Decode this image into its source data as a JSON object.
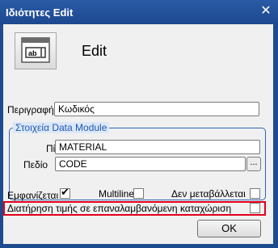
{
  "window": {
    "title": "Ιδιότητες Edit",
    "close_glyph": "✕"
  },
  "header": {
    "icon": "edit-control-icon",
    "icon_text": "ab",
    "title": "Edit"
  },
  "description": {
    "label": "Περιγραφή",
    "value": "Κωδικός"
  },
  "data_module": {
    "group_title": "Στοιχεία Data Module",
    "table_label": "Πίνακας",
    "table_value": "MATERIAL",
    "field_label": "Πεδίο",
    "field_value": "CODE",
    "browse_label": "..."
  },
  "options": {
    "visible_label": "Εμφανίζεται",
    "visible_checked": true,
    "multiline_label": "Multiline",
    "multiline_checked": false,
    "readonly_label": "Δεν μεταβάλλεται",
    "readonly_checked": false,
    "keep_value_label": "Διατήρηση τιμής σε επαναλαμβανόμενη καταχώριση",
    "keep_value_checked": false,
    "highlight_color": "#e3001b"
  },
  "ok_button": "OK"
}
